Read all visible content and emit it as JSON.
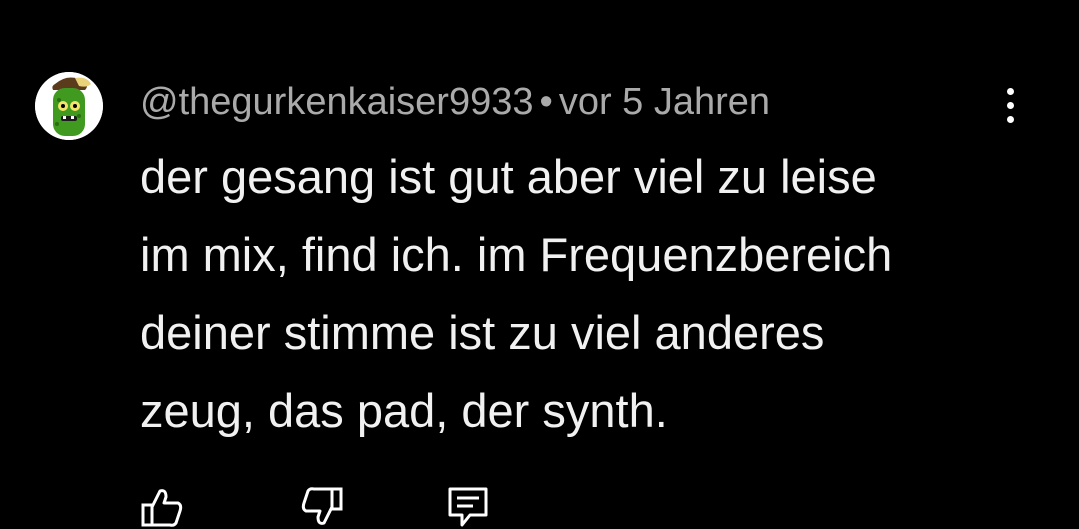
{
  "comment": {
    "author": "@thegurkenkaiser9933",
    "separator": "•",
    "timestamp": "vor 5 Jahren",
    "text_lines": [
      "der gesang ist gut aber viel zu leise",
      "im mix, find ich. im Frequenzbereich",
      "deiner stimme ist zu viel anderes",
      "zeug, das pad, der synth."
    ],
    "icons": {
      "avatar": "cucumber-avatar",
      "more": "more-vertical-icon",
      "like": "thumbs-up-icon",
      "dislike": "thumbs-down-icon",
      "reply": "reply-comment-icon"
    }
  },
  "colors": {
    "background": "#000000",
    "text": "#f1f1f1",
    "secondary_text": "#aaaaaa",
    "avatar_green": "#3f9a1f"
  }
}
